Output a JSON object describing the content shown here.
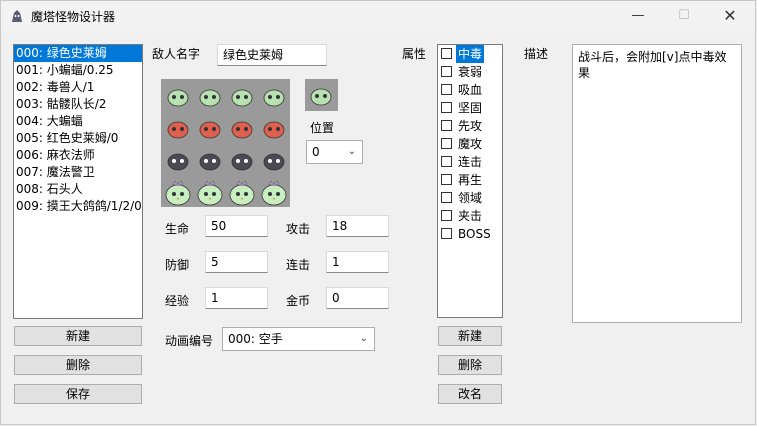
{
  "window": {
    "title": "魔塔怪物设计器",
    "minimize_glyph": "—",
    "maximize_glyph": "☐",
    "close_glyph": "✕"
  },
  "monster_list": [
    "000: 绿色史莱姆",
    "001: 小蝙蝠/0.25",
    "002: 毒兽人/1",
    "003: 骷髅队长/2",
    "004: 大蝙蝠",
    "005: 红色史莱姆/0",
    "006: 麻衣法师",
    "007: 魔法警卫",
    "008: 石头人",
    "009: 摸王大鸽鸽/1/2/0"
  ],
  "selected_monster_index": 0,
  "list_buttons": {
    "new": "新建",
    "delete": "删除",
    "save": "保存"
  },
  "name_label": "敌人名字",
  "name_value": "绿色史莱姆",
  "position_label": "位置",
  "position_value": "0",
  "stats": {
    "hp_label": "生命",
    "hp": "50",
    "atk_label": "攻击",
    "atk": "18",
    "def_label": "防御",
    "def": "5",
    "combo_label": "连击",
    "combo": "1",
    "exp_label": "经验",
    "exp": "1",
    "gold_label": "金币",
    "gold": "0"
  },
  "animation_label": "动画编号",
  "animation_value": "000: 空手",
  "attributes_label": "属性",
  "attributes": [
    "中毒",
    "衰弱",
    "吸血",
    "坚固",
    "先攻",
    "魔攻",
    "连击",
    "再生",
    "领域",
    "夹击",
    "BOSS"
  ],
  "selected_attribute_index": 0,
  "attr_buttons": {
    "new": "新建",
    "delete": "删除",
    "rename": "改名"
  },
  "desc_label": "描述",
  "description": "战斗后，会附加[v]点中毒效果",
  "colors": {
    "selection": "#0078d7",
    "sprite_bg": "#9a9a9a"
  },
  "sprite_rows": [
    "green-slime",
    "red-slime",
    "dark-slime",
    "slime-king"
  ]
}
